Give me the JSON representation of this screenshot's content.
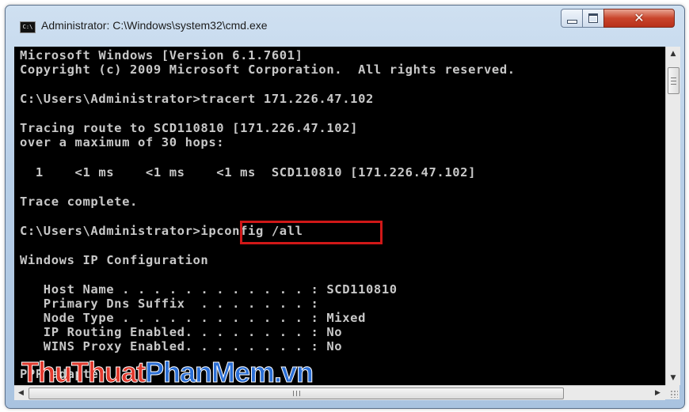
{
  "window": {
    "title": "Administrator: C:\\Windows\\system32\\cmd.exe",
    "icon_text": "C:\\",
    "icons": {
      "minimize": "minimize-icon",
      "maximize": "maximize-icon",
      "close": "close-icon",
      "app": "cmd-icon"
    }
  },
  "console": {
    "lines": [
      "Microsoft Windows [Version 6.1.7601]",
      "Copyright (c) 2009 Microsoft Corporation.  All rights reserved.",
      "C:\\Users\\Administrator>tracert 171.226.47.102",
      "Tracing route to SCD110810 [171.226.47.102]",
      "over a maximum of 30 hops:",
      "  1    <1 ms    <1 ms    <1 ms  SCD110810 [171.226.47.102]",
      "Trace complete.",
      "C:\\Users\\Administrator>ipconfig /all",
      "Windows IP Configuration",
      "   Host Name . . . . . . . . . . . . : SCD110810",
      "   Primary Dns Suffix  . . . . . . . :",
      "   Node Type . . . . . . . . . . . . : Mixed",
      "   IP Routing Enabled. . . . . . . . : No",
      "   WINS Proxy Enabled. . . . . . . . : No",
      "PPP adapter"
    ],
    "text_color": "#c8c8c8",
    "background": "#000000",
    "highlight_color": "#d01818"
  },
  "watermark": {
    "part1": "ThuThuat",
    "part2": "PhanMem.vn",
    "color1": "#e23a2e",
    "color2": "#2b6fd6"
  },
  "scrollbars": {
    "up_arrow": "▲",
    "down_arrow": "▼",
    "left_arrow": "◀",
    "right_arrow": "▶"
  }
}
